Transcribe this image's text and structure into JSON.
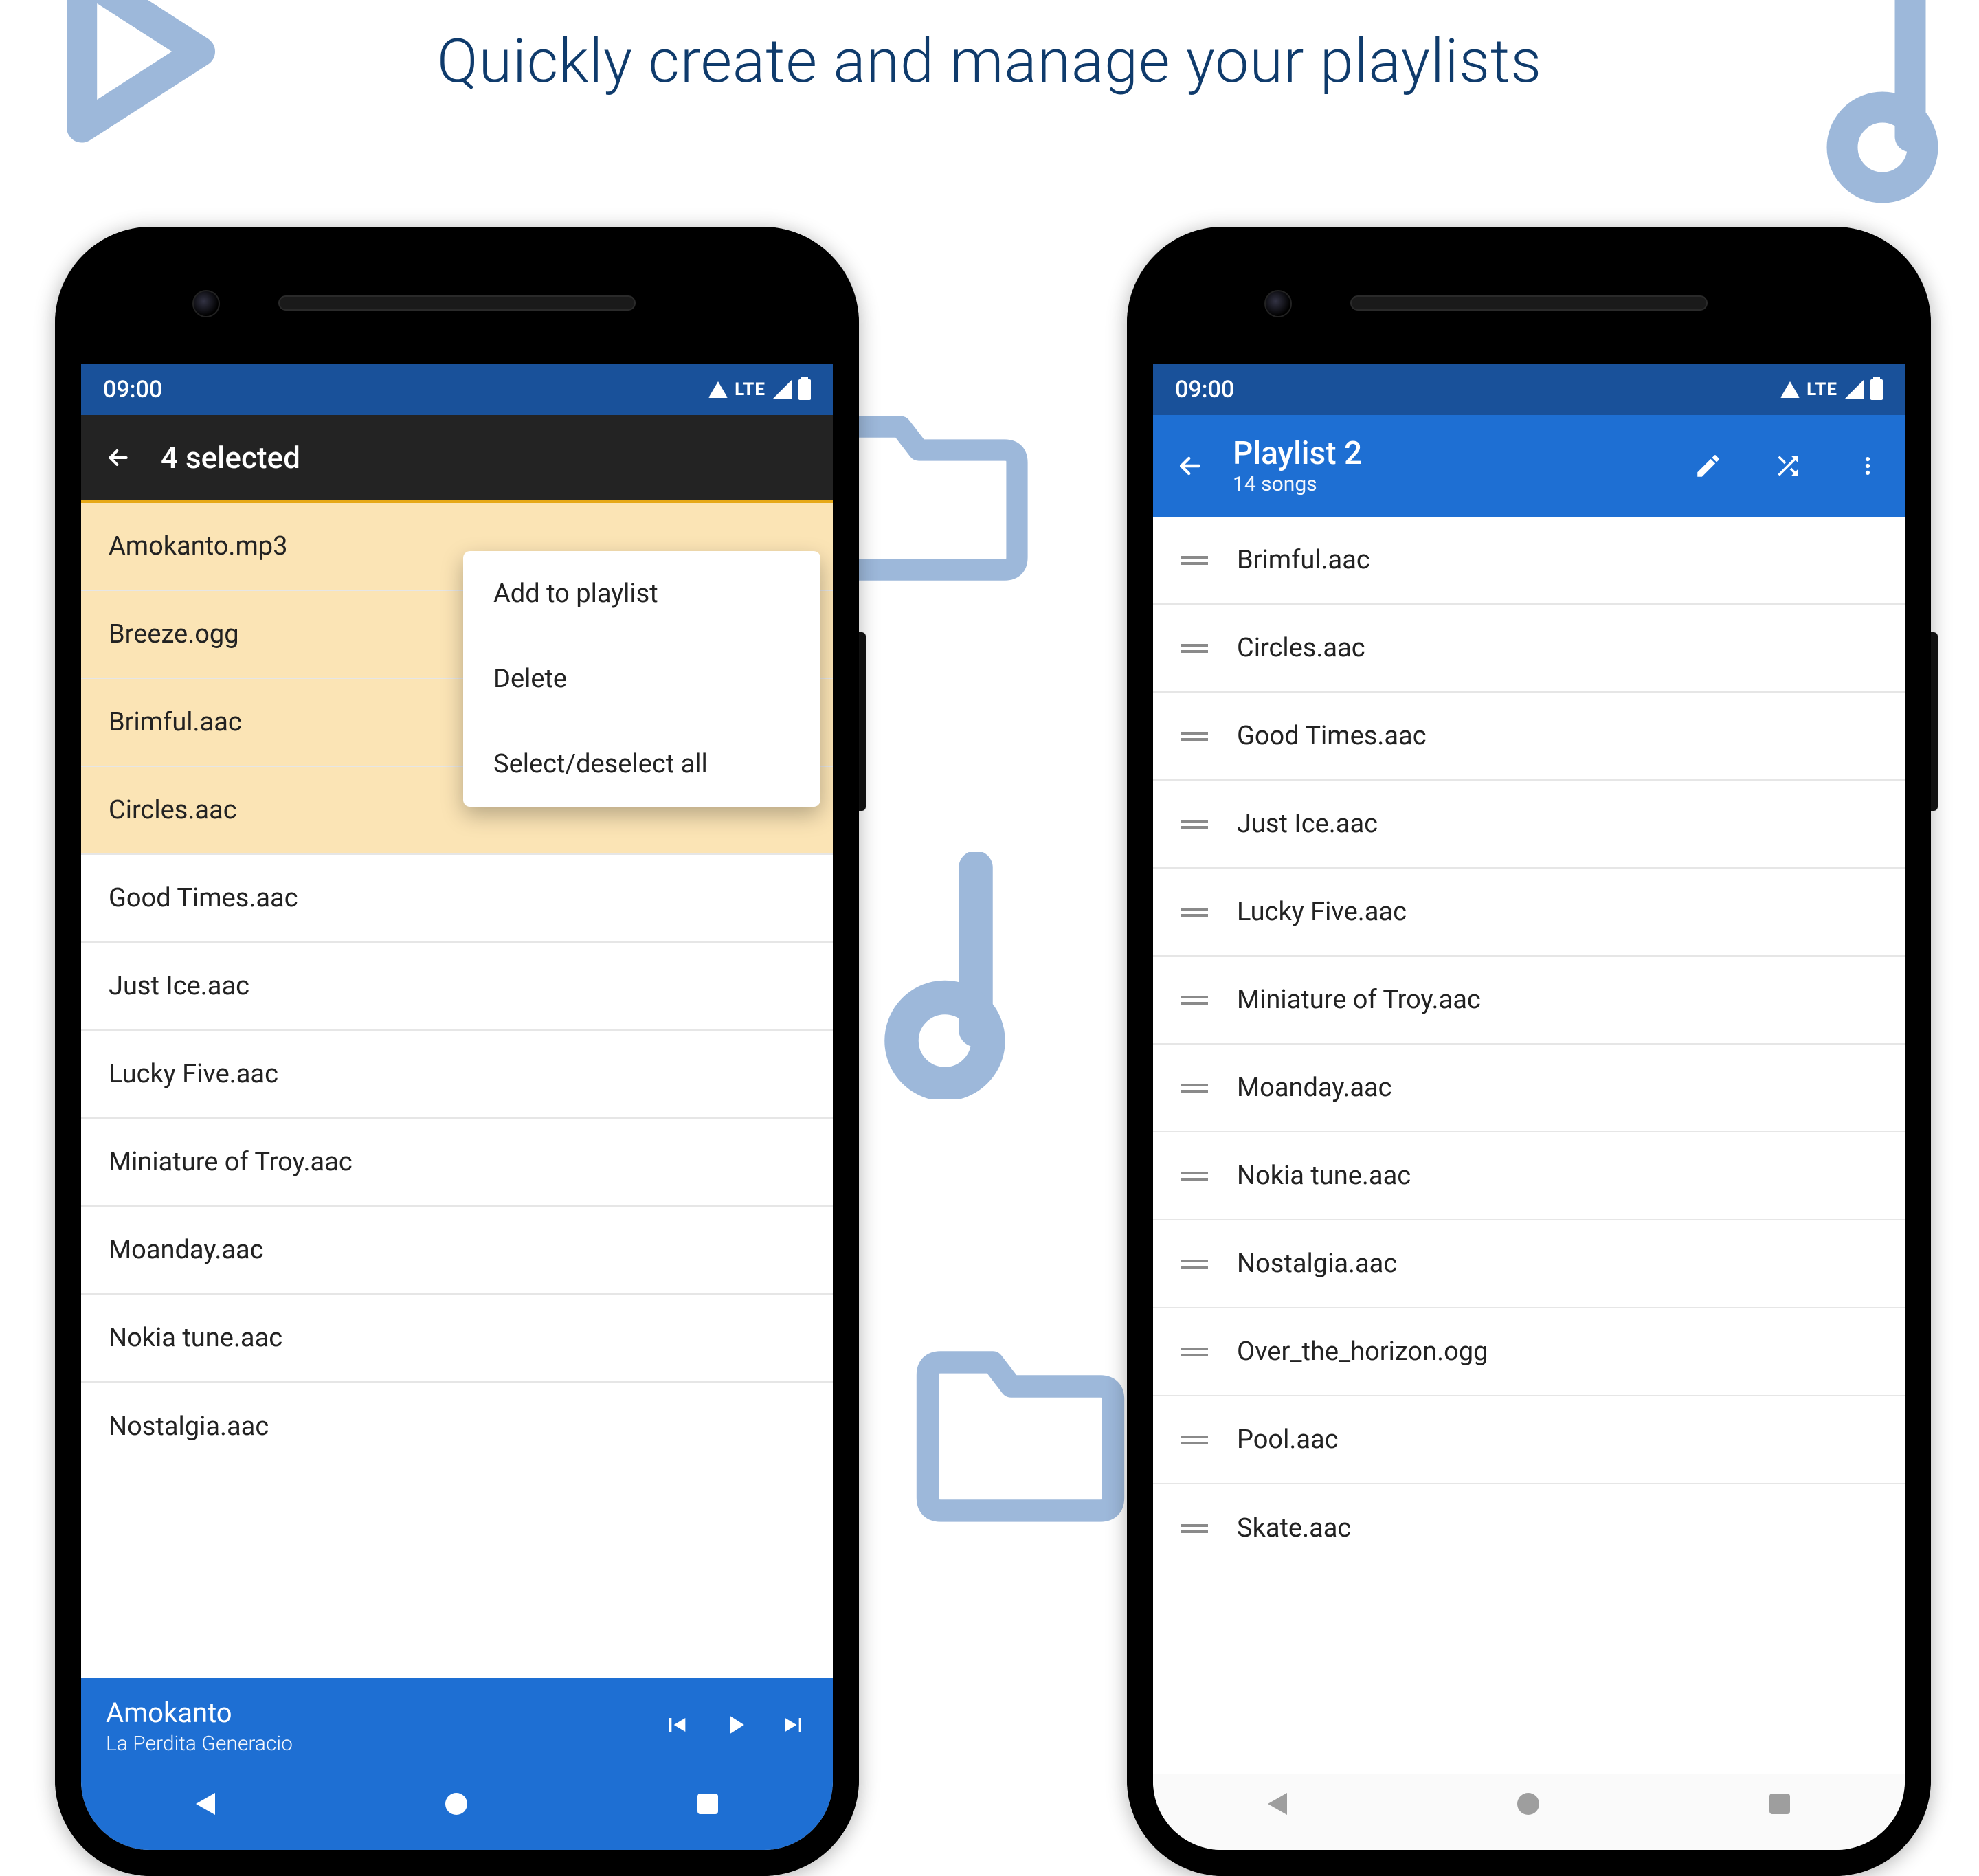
{
  "tagline": "Quickly create and manage your playlists",
  "status": {
    "time": "09:00",
    "net": "LTE"
  },
  "left": {
    "appbar_title": "4 selected",
    "menu": {
      "add": "Add to playlist",
      "delete": "Delete",
      "toggle": "Select/deselect all"
    },
    "items": [
      {
        "name": "Amokanto.mp3",
        "selected": true
      },
      {
        "name": "Breeze.ogg",
        "selected": true
      },
      {
        "name": "Brimful.aac",
        "selected": true
      },
      {
        "name": "Circles.aac",
        "selected": true
      },
      {
        "name": "Good Times.aac",
        "selected": false
      },
      {
        "name": "Just Ice.aac",
        "selected": false
      },
      {
        "name": "Lucky Five.aac",
        "selected": false
      },
      {
        "name": "Miniature of Troy.aac",
        "selected": false
      },
      {
        "name": "Moanday.aac",
        "selected": false
      },
      {
        "name": "Nokia tune.aac",
        "selected": false
      },
      {
        "name": "Nostalgia.aac",
        "selected": false
      }
    ],
    "nowplaying": {
      "title": "Amokanto",
      "artist": "La Perdita Generacio"
    }
  },
  "right": {
    "title": "Playlist 2",
    "subtitle": "14 songs",
    "items": [
      "Brimful.aac",
      "Circles.aac",
      "Good Times.aac",
      "Just Ice.aac",
      "Lucky Five.aac",
      "Miniature of Troy.aac",
      "Moanday.aac",
      "Nokia tune.aac",
      "Nostalgia.aac",
      "Over_the_horizon.ogg",
      "Pool.aac",
      "Skate.aac"
    ]
  }
}
